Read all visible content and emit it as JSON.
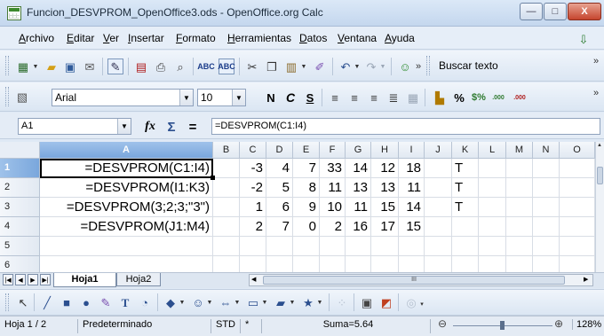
{
  "window": {
    "title": "Funcion_DESVPROM_OpenOffice3.ods - OpenOffice.org Calc",
    "minimize": "—",
    "maximize": "□",
    "close": "X"
  },
  "menu": [
    {
      "label": "Archivo"
    },
    {
      "label": "Editar"
    },
    {
      "label": "Ver"
    },
    {
      "label": "Insertar"
    },
    {
      "label": "Formato"
    },
    {
      "label": "Herramientas"
    },
    {
      "label": "Datos"
    },
    {
      "label": "Ventana"
    },
    {
      "label": "Ayuda"
    }
  ],
  "toolbar": {
    "search_text": "Buscar texto",
    "overflow": "»"
  },
  "format_toolbar": {
    "font_name": "Arial",
    "font_size": "10",
    "bold": "N",
    "italic": "C",
    "underline": "S",
    "currency": "%",
    "decimal_add": ".000",
    "decimal_remove": ".000"
  },
  "formula_bar": {
    "cell_ref": "A1",
    "function_label": "fx",
    "sum_label": "Σ",
    "equals_label": "=",
    "formula": "=DESVPROM(C1:I4)"
  },
  "columns": [
    "A",
    "B",
    "C",
    "D",
    "E",
    "F",
    "G",
    "H",
    "I",
    "J",
    "K",
    "L",
    "M",
    "N",
    "O"
  ],
  "rows": [
    {
      "num": "1",
      "a": "=DESVPROM(C1:I4)",
      "vals": [
        "-3",
        "4",
        "7",
        "33",
        "14",
        "12",
        "18"
      ],
      "k": "T"
    },
    {
      "num": "2",
      "a": "=DESVPROM(I1:K3)",
      "vals": [
        "-2",
        "5",
        "8",
        "11",
        "13",
        "13",
        "11"
      ],
      "k": "T"
    },
    {
      "num": "3",
      "a": "=DESVPROM(3;2;3;\"3\")",
      "vals": [
        "1",
        "6",
        "9",
        "10",
        "11",
        "15",
        "14"
      ],
      "k": "T"
    },
    {
      "num": "4",
      "a": "=DESVPROM(J1:M4)",
      "vals": [
        "2",
        "7",
        "0",
        "2",
        "16",
        "17",
        "15"
      ],
      "k": ""
    },
    {
      "num": "5",
      "a": "",
      "vals": [
        "",
        "",
        "",
        "",
        "",
        "",
        ""
      ],
      "k": ""
    },
    {
      "num": "6",
      "a": "",
      "vals": [
        "",
        "",
        "",
        "",
        "",
        "",
        ""
      ],
      "k": ""
    }
  ],
  "sheets": {
    "tab1": "Hoja1",
    "tab2": "Hoja2",
    "hscroll_mid": "III"
  },
  "status": {
    "page": "Hoja 1 / 2",
    "style": "Predeterminado",
    "mode": "STD",
    "modified": "*",
    "sum": "Suma=5.64",
    "zoom": "128%"
  },
  "colors": {
    "selected_header": "#7aa7dc",
    "window_bg": "#dfe9f5"
  }
}
